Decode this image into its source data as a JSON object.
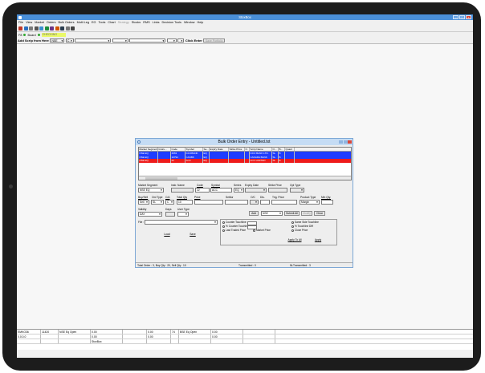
{
  "app_title": "StoxBox",
  "menu": [
    "File",
    "View",
    "Market",
    "Orders",
    "Bulk Orders",
    "Multi Leg",
    "EG",
    "Tools",
    "Chart",
    "Strategy",
    "Stocks",
    "RMS",
    "Links",
    "Decision Tools",
    "Window",
    "Help"
  ],
  "menu_dim_index": 9,
  "toolbar_icons": [
    "new-icon",
    "open-icon",
    "save-icon",
    "print-icon",
    "copy-icon",
    "chart-icon",
    "grid-icon",
    "color-icon",
    "settings-icon",
    "cross-icon",
    "close-icon"
  ],
  "row2": {
    "prefix": "F8",
    "board_label": "Board",
    "yellow_text": "CHECKING"
  },
  "scrip_bar": {
    "label": "Add Scrip from Here",
    "exchange": "NSE",
    "segment": "C",
    "click_enter_label": "Click Enter",
    "save_portfolio_label": "Save Portfolio"
  },
  "dialog": {
    "title": "Bulk Order Entry - Untitled.txt",
    "columns": [
      "Market Segment",
      "Instru...",
      "Code",
      "Symbol",
      "Se...",
      "Expiry Date",
      "Strike Price",
      "O.",
      "Scrip Name",
      "O...",
      "B...",
      "Quant"
    ],
    "rows": [
      [
        "NSE EQ",
        "",
        "4963",
        "ICICIBANK",
        "EQ",
        "",
        "",
        "",
        "ICICI BANK LTD.",
        "SL",
        "B",
        ""
      ],
      [
        "NSE EQ",
        "",
        "10794",
        "CANBK",
        "EQ",
        "",
        "",
        "",
        "CANARA BANK",
        "SL",
        "B",
        ""
      ],
      [
        "NSE EQ",
        "",
        "22",
        "ACC",
        "EQ",
        "",
        "",
        "",
        "ACC LIMITED",
        "SL",
        "B",
        ""
      ]
    ],
    "row_colors": [
      "blue",
      "blue",
      "red"
    ],
    "labels": {
      "market_segment": "Market Segment",
      "instr_name": "Instr. Name",
      "code": "Code",
      "symbol": "Symbol",
      "series": "Series",
      "expiry_date": "Expiry Date",
      "strike_price": "Strike Price",
      "opt_type": "Opt Type",
      "buy_sell": "Buy/Sell",
      "ord_type": "Ord Type",
      "ca": "C/A",
      "total_qty": "Total Qty",
      "price": "Price",
      "settlor": "Settlor",
      "oc": "O/C",
      "dis": "Dis.",
      "trg_price": "Trig. Price",
      "product_type": "Product Type",
      "min_qty": "Min Qty.",
      "validity": "Validity",
      "days": "Days",
      "user_type": "User Type",
      "file": "File :"
    },
    "values": {
      "market_segment": "NSE EQ",
      "code": "22",
      "symbol": "ACC",
      "series": "EQ",
      "buy_sell": "Sell",
      "ord_type": "SL",
      "ca": "C",
      "total_qty": "10",
      "validity": "DAY",
      "product_type": "Margin",
      "settlor_exchange": "NSE"
    },
    "buttons": {
      "add": "Add",
      "submit_all": "Submit All",
      "modify": "Modify",
      "clear": "Clear",
      "load": "Load",
      "save": "Save",
      "apply_to_all": "Apply To All",
      "apply": "Apply"
    },
    "radio_left": [
      "Counter Touchline",
      "% Counter Touchline",
      "Last Traded Price",
      "Market Price"
    ],
    "radio_right": [
      "Same Side Touchline",
      "% Touchline Diff",
      "Close Price"
    ],
    "status": {
      "total_order": "Total Order : 3, Buy Qty : 20, Sell Qty : 10",
      "transmitted": "Transmitted : 0",
      "nl_transmitted": "NLTransmitted : 3"
    }
  },
  "ticker": {
    "row1": [
      "EMKO36",
      "11420",
      "NSE Eq Open",
      "0.00",
      "",
      "0.00",
      "74",
      "BSE Eq Open",
      "0.00",
      ""
    ],
    "row2": [
      "0.0.0.0",
      "",
      "",
      "0.00",
      "",
      "0.00",
      "",
      "",
      "0.00",
      ""
    ],
    "row3": [
      "",
      "",
      "",
      "StoxBox",
      "",
      "",
      "",
      "",
      "",
      ""
    ]
  },
  "colors": {
    "titlebar": "#4a8fd8",
    "row_blue": "#1f3cff",
    "row_red": "#ee1b1b",
    "yellow": "#eaf96a"
  }
}
